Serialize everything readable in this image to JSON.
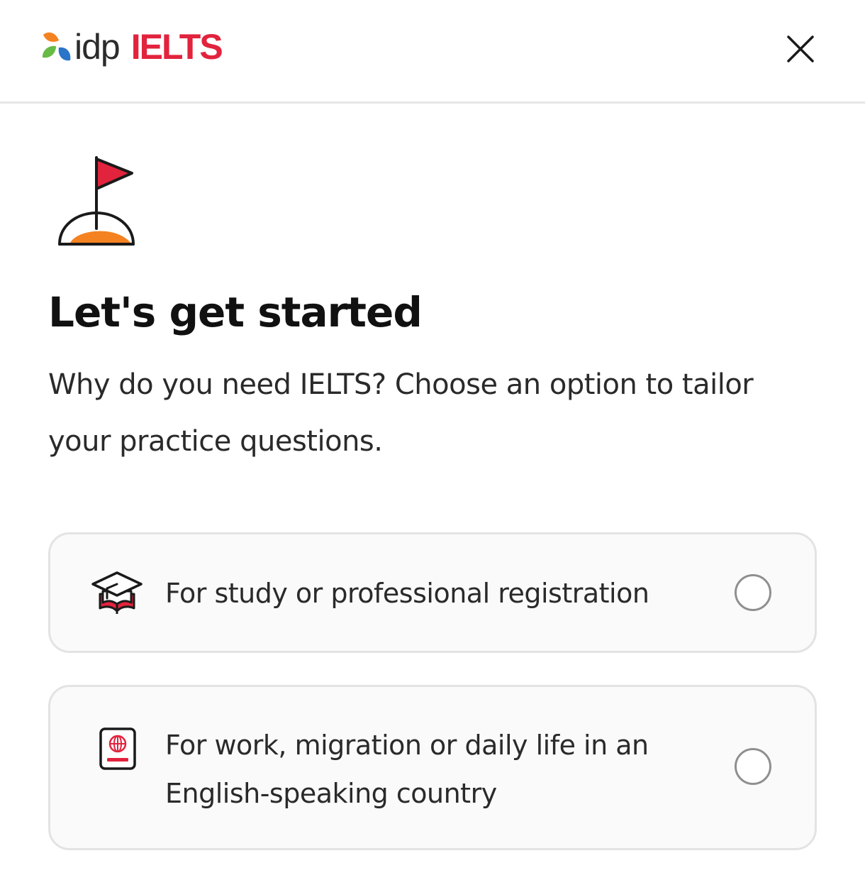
{
  "header": {
    "brand": {
      "idp_text": "idp",
      "ielts_text": "IELTS",
      "colors": {
        "ielts_red": "#e2233d",
        "leaf_orange": "#f58220",
        "leaf_green": "#66bb46",
        "leaf_blue": "#2a74c9"
      }
    },
    "close_icon": "close-icon"
  },
  "main": {
    "illustration_icon": "flag-in-hole-icon",
    "title": "Let's get started",
    "subtitle": "Why do you need IELTS? Choose an option to tailor your practice questions.",
    "options": [
      {
        "icon": "graduation-cap-icon",
        "label": "For study or professional registration",
        "selected": false
      },
      {
        "icon": "passport-icon",
        "label": "For work, migration or daily life in an English-speaking country",
        "selected": false
      }
    ]
  }
}
